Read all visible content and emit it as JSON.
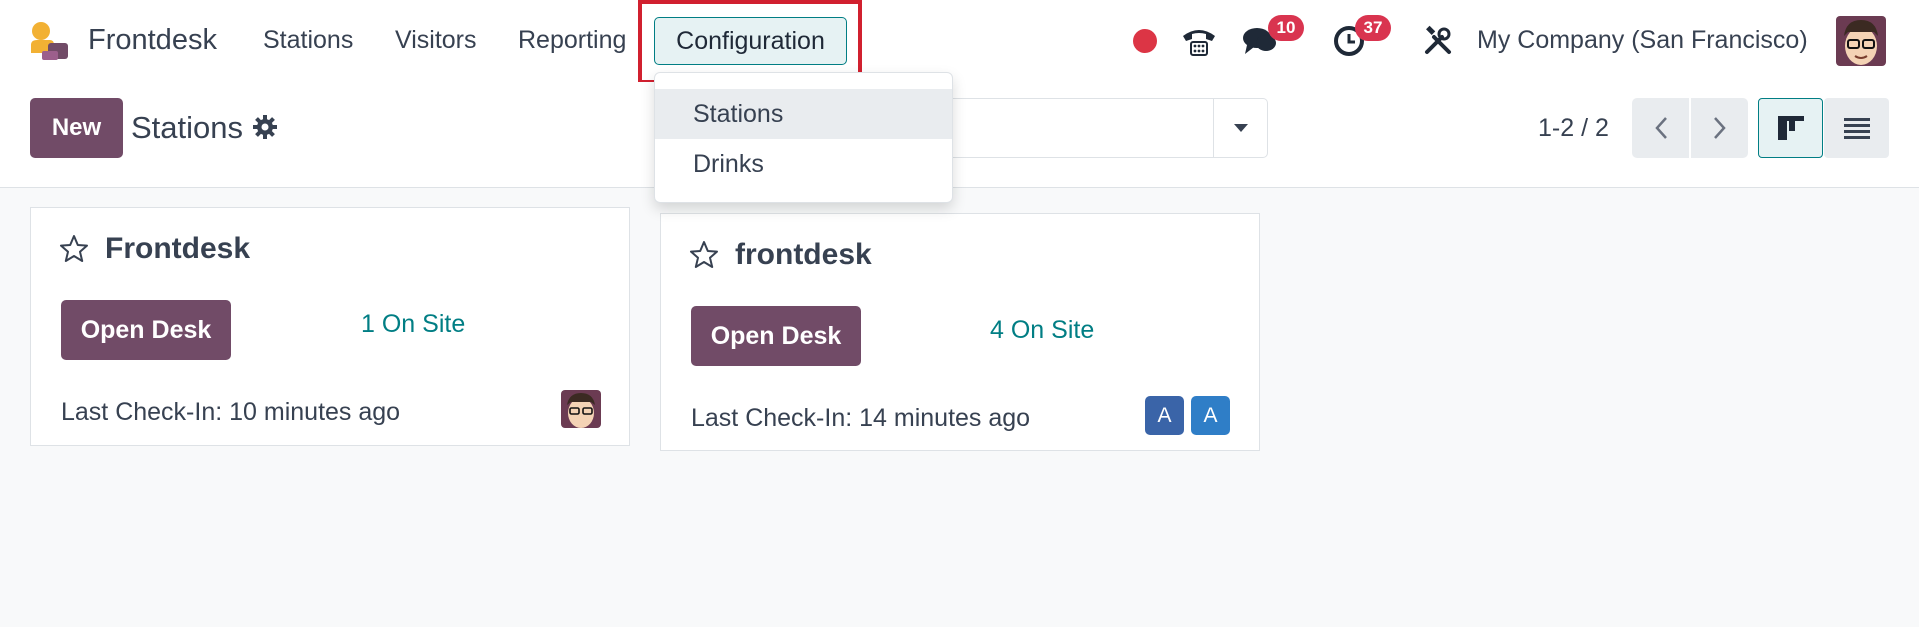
{
  "navbar": {
    "app_name": "Frontdesk",
    "menus": [
      "Stations",
      "Visitors",
      "Reporting"
    ],
    "active_menu": "Configuration",
    "messages_count": "10",
    "activities_count": "37",
    "company": "My Company (San Francisco)"
  },
  "control_panel": {
    "new_label": "New",
    "breadcrumb": "Stations",
    "pager": "1-2 / 2"
  },
  "dropdown": {
    "items": [
      "Stations",
      "Drinks"
    ]
  },
  "cards": [
    {
      "title": "Frontdesk",
      "button": "Open Desk",
      "on_site": "1 On Site",
      "last_checkin": "Last Check-In: 10 minutes ago"
    },
    {
      "title": "frontdesk",
      "button": "Open Desk",
      "on_site": "4 On Site",
      "last_checkin": "Last Check-In: 14 minutes ago",
      "avatars": [
        "A",
        "A"
      ]
    }
  ],
  "colors": {
    "brand": "#714b67",
    "accent": "#017e84",
    "badge": "#d9344f",
    "highlight": "#d1202f"
  }
}
